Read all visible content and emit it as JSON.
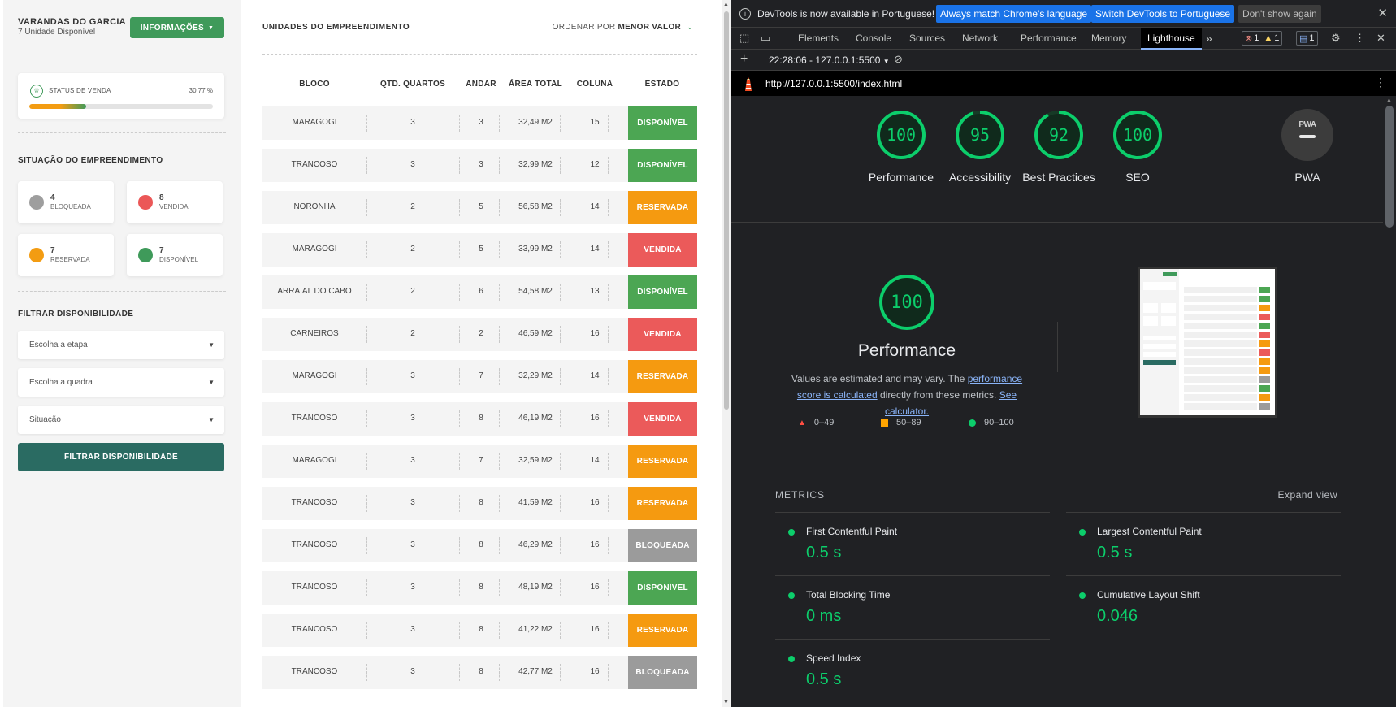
{
  "sidebar": {
    "project_name": "VARANDAS DO GARCIA",
    "project_sub": "7 Unidade Disponível",
    "info_button": "INFORMAÇÕES",
    "status_label": "STATUS DE VENDA",
    "status_percent": "30.77 %",
    "status_value": 0.3077,
    "situacao_title": "SITUAÇÃO DO EMPREENDIMENTO",
    "counts": [
      {
        "num": "4",
        "label": "BLOQUEADA",
        "color": "#9e9e9e"
      },
      {
        "num": "8",
        "label": "VENDIDA",
        "color": "#eb5757"
      },
      {
        "num": "7",
        "label": "RESERVADA",
        "color": "#f39c12"
      },
      {
        "num": "7",
        "label": "DISPONÍVEL",
        "color": "#3f9a5a"
      }
    ],
    "filtrar_title": "FILTRAR DISPONIBILIDADE",
    "selects": [
      "Escolha a etapa",
      "Escolha a quadra",
      "Situação"
    ],
    "filter_button": "FILTRAR DISPONIBILIDADE"
  },
  "main": {
    "title": "UNIDADES DO EMPREENDIMENTO",
    "sort_prefix": "ORDENAR POR",
    "sort_value": "MENOR VALOR",
    "headers": [
      "BLOCO",
      "QTD. QUARTOS",
      "ANDAR",
      "ÁREA TOTAL",
      "COLUNA",
      "ESTADO"
    ],
    "rows": [
      [
        "MARAGOGI",
        "3",
        "3",
        "32,49 M2",
        "15",
        "DISPONÍVEL"
      ],
      [
        "TRANCOSO",
        "3",
        "3",
        "32,99 M2",
        "12",
        "DISPONÍVEL"
      ],
      [
        "NORONHA",
        "2",
        "5",
        "56,58 M2",
        "14",
        "RESERVADA"
      ],
      [
        "MARAGOGI",
        "2",
        "5",
        "33,99 M2",
        "14",
        "VENDIDA"
      ],
      [
        "ARRAIAL DO CABO",
        "2",
        "6",
        "54,58 M2",
        "13",
        "DISPONÍVEL"
      ],
      [
        "CARNEIROS",
        "2",
        "2",
        "46,59 M2",
        "16",
        "VENDIDA"
      ],
      [
        "MARAGOGI",
        "3",
        "7",
        "32,29 M2",
        "14",
        "RESERVADA"
      ],
      [
        "TRANCOSO",
        "3",
        "8",
        "46,19 M2",
        "16",
        "VENDIDA"
      ],
      [
        "MARAGOGI",
        "3",
        "7",
        "32,59 M2",
        "14",
        "RESERVADA"
      ],
      [
        "TRANCOSO",
        "3",
        "8",
        "41,59 M2",
        "16",
        "RESERVADA"
      ],
      [
        "TRANCOSO",
        "3",
        "8",
        "46,29 M2",
        "16",
        "BLOQUEADA"
      ],
      [
        "TRANCOSO",
        "3",
        "8",
        "48,19 M2",
        "16",
        "DISPONÍVEL"
      ],
      [
        "TRANCOSO",
        "3",
        "8",
        "41,22 M2",
        "16",
        "RESERVADA"
      ],
      [
        "TRANCOSO",
        "3",
        "8",
        "42,77 M2",
        "16",
        "BLOQUEADA"
      ]
    ],
    "state_colors": {
      "DISPONÍVEL": "#4ca653",
      "RESERVADA": "#f59a10",
      "VENDIDA": "#eb5a5a",
      "BLOQUEADA": "#9b9b9b"
    }
  },
  "devtools": {
    "infobar_message": "DevTools is now available in Portuguese!",
    "infobar_btn1": "Always match Chrome's language",
    "infobar_btn2": "Switch DevTools to Portuguese",
    "infobar_btn3": "Don't show again",
    "tabs": [
      "Elements",
      "Console",
      "Sources",
      "Network",
      "Performance",
      "Memory",
      "Lighthouse"
    ],
    "active_tab": "Lighthouse",
    "error_count": "1",
    "warning_count": "1",
    "info_count": "1",
    "report_selector": "22:28:06 - 127.0.0.1:5500",
    "url": "http://127.0.0.1:5500/index.html",
    "scores": [
      {
        "score": "100",
        "value": 100,
        "label": "Performance"
      },
      {
        "score": "95",
        "value": 95,
        "label": "Accessibility"
      },
      {
        "score": "92",
        "value": 92,
        "label": "Best Practices"
      },
      {
        "score": "100",
        "value": 100,
        "label": "SEO"
      }
    ],
    "pwa_label": "PWA",
    "pwa_badge": "PWA",
    "perf_score": "100",
    "perf_title": "Performance",
    "perf_desc_1": "Values are estimated and may vary. The",
    "perf_link_1": "performance score is calculated",
    "perf_desc_2": "directly from these metrics.",
    "perf_link_2": "See calculator.",
    "legend": [
      "0–49",
      "50–89",
      "90–100"
    ],
    "metrics_title": "METRICS",
    "expand_view": "Expand view",
    "metrics": [
      {
        "label": "First Contentful Paint",
        "value": "0.5 s"
      },
      {
        "label": "Largest Contentful Paint",
        "value": "0.5 s"
      },
      {
        "label": "Total Blocking Time",
        "value": "0 ms"
      },
      {
        "label": "Cumulative Layout Shift",
        "value": "0.046"
      },
      {
        "label": "Speed Index",
        "value": "0.5 s"
      }
    ],
    "colors": {
      "pass": "#0cce6b",
      "average": "#ffa400",
      "fail": "#ff4e42"
    }
  }
}
